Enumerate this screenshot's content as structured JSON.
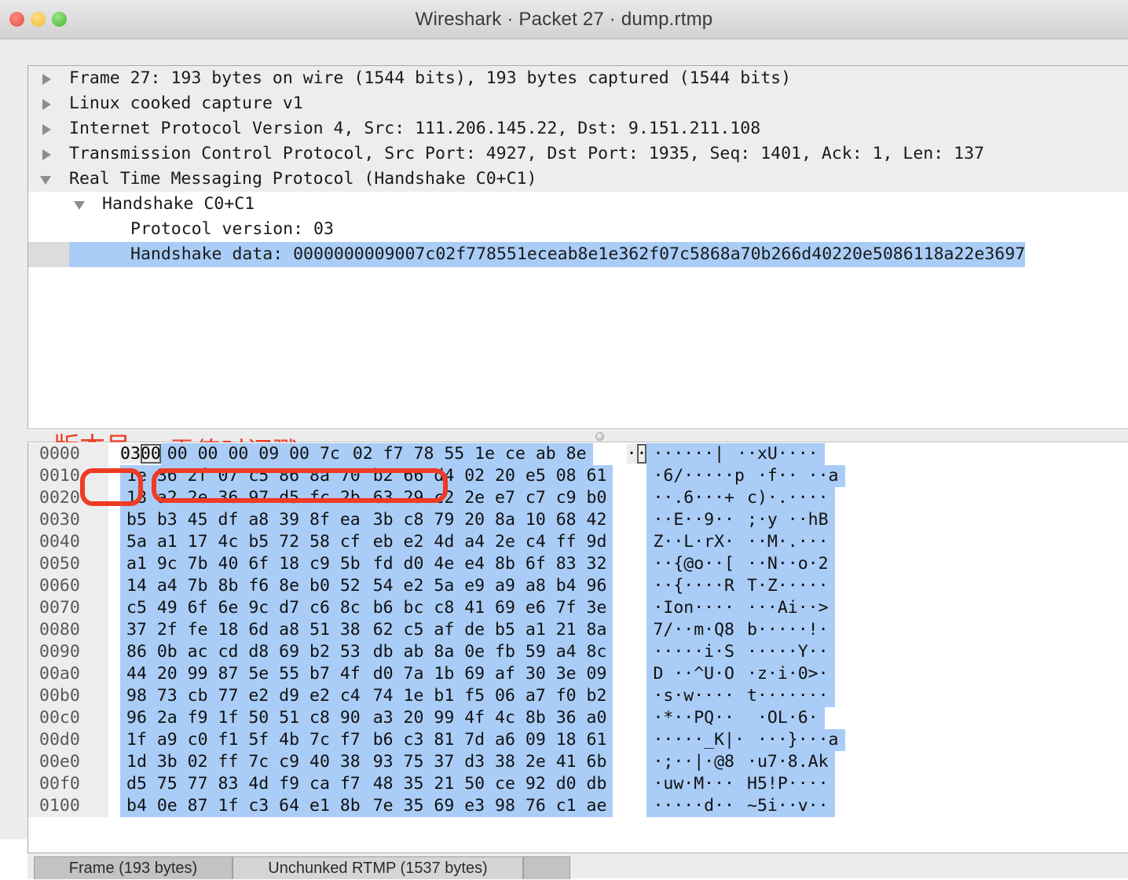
{
  "window": {
    "title": "Wireshark · Packet 27 · dump.rtmp",
    "traffic_lights": [
      "close-red",
      "minimize-yellow",
      "zoom-green"
    ]
  },
  "detail_tree": [
    {
      "level": 0,
      "toggle": "collapsed",
      "text": "Frame 27: 193 bytes on wire (1544 bits), 193 bytes captured (1544 bits)",
      "selected": false
    },
    {
      "level": 0,
      "toggle": "collapsed",
      "text": "Linux cooked capture v1",
      "selected": false
    },
    {
      "level": 0,
      "toggle": "collapsed",
      "text": "Internet Protocol Version 4, Src: 111.206.145.22, Dst: 9.151.211.108",
      "selected": false
    },
    {
      "level": 0,
      "toggle": "collapsed",
      "text": "Transmission Control Protocol, Src Port: 4927, Dst Port: 1935, Seq: 1401, Ack: 1, Len: 137",
      "selected": false
    },
    {
      "level": 0,
      "toggle": "expanded",
      "text": "Real Time Messaging Protocol (Handshake C0+C1)",
      "selected": false
    },
    {
      "level": 1,
      "toggle": "expanded",
      "text": "Handshake C0+C1",
      "selected": false
    },
    {
      "level": 2,
      "toggle": "none",
      "text": "Protocol version: 03",
      "selected": false
    },
    {
      "level": 2,
      "toggle": "none",
      "text": "Handshake data: 0000000009007c02f778551eceab8e1e362f07c5868a70b266d40220e5086118a22e3697",
      "selected": true
    }
  ],
  "annotations": [
    {
      "name": "version-number-label",
      "text": "版本号",
      "color": "#ef3b24"
    },
    {
      "name": "zero-timestamp-label",
      "text": "零值时间戳",
      "color": "#ef3b24"
    }
  ],
  "hex_dump": {
    "rows": [
      {
        "offset": "0000",
        "left": "03 00 00 00 00 09 00 7c",
        "right": "02 f7 78 55 1e ce ab 8e",
        "ascii_left": "········|",
        "ascii_right": "··xU····"
      },
      {
        "offset": "0010",
        "left": "1e 36 2f 07 c5 86 8a 70",
        "right": "b2 66 d4 02 20 e5 08 61",
        "ascii_left": "·6/·····p",
        "ascii_right": "·f·· ··a"
      },
      {
        "offset": "0020",
        "left": "18 a2 2e 36 97 d5 fc 2b",
        "right": "63 29 c2 2e e7 c7 c9 b0",
        "ascii_left": "··.6···+",
        "ascii_right": "c)·.····"
      },
      {
        "offset": "0030",
        "left": "b5 b3 45 df a8 39 8f ea",
        "right": "3b c8 79 20 8a 10 68 42",
        "ascii_left": "··E··9··",
        "ascii_right": ";·y ··hB"
      },
      {
        "offset": "0040",
        "left": "5a a1 17 4c b5 72 58 cf",
        "right": "eb e2 4d a4 2e c4 ff 9d",
        "ascii_left": "Z··L·rX·",
        "ascii_right": "··M·.···"
      },
      {
        "offset": "0050",
        "left": "a1 9c 7b 40 6f 18 c9 5b",
        "right": "fd d0 4e e4 8b 6f 83 32",
        "ascii_left": "··{@o··[",
        "ascii_right": "··N··o·2"
      },
      {
        "offset": "0060",
        "left": "14 a4 7b 8b f6 8e b0 52",
        "right": "54 e2 5a e9 a9 a8 b4 96",
        "ascii_left": "··{····R",
        "ascii_right": "T·Z·····"
      },
      {
        "offset": "0070",
        "left": "c5 49 6f 6e 9c d7 c6 8c",
        "right": "b6 bc c8 41 69 e6 7f 3e",
        "ascii_left": "·Ion····",
        "ascii_right": "···Ai··>"
      },
      {
        "offset": "0080",
        "left": "37 2f fe 18 6d a8 51 38",
        "right": "62 c5 af de b5 a1 21 8a",
        "ascii_left": "7/··m·Q8",
        "ascii_right": "b·····!·"
      },
      {
        "offset": "0090",
        "left": "86 0b ac cd d8 69 b2 53",
        "right": "db ab 8a 0e fb 59 a4 8c",
        "ascii_left": "·····i·S",
        "ascii_right": "·····Y··"
      },
      {
        "offset": "00a0",
        "left": "44 20 99 87 5e 55 b7 4f",
        "right": "d0 7a 1b 69 af 30 3e 09",
        "ascii_left": "D ··^U·O",
        "ascii_right": "·z·i·0>·"
      },
      {
        "offset": "00b0",
        "left": "98 73 cb 77 e2 d9 e2 c4",
        "right": "74 1e b1 f5 06 a7 f0 b2",
        "ascii_left": "·s·w····",
        "ascii_right": "t·······"
      },
      {
        "offset": "00c0",
        "left": "96 2a f9 1f 50 51 c8 90",
        "right": "a3 20 99 4f 4c 8b 36 a0",
        "ascii_left": "·*··PQ··",
        "ascii_right": " ·OL·6·"
      },
      {
        "offset": "00d0",
        "left": "1f a9 c0 f1 5f 4b 7c f7",
        "right": "b6 c3 81 7d a6 09 18 61",
        "ascii_left": "·····_K|·",
        "ascii_right": "···}···a"
      },
      {
        "offset": "00e0",
        "left": "1d 3b 02 ff 7c c9 40 38",
        "right": "93 75 37 d3 38 2e 41 6b",
        "ascii_left": "·;··|·@8",
        "ascii_right": "·u7·8.Ak"
      },
      {
        "offset": "00f0",
        "left": "d5 75 77 83 4d f9 ca f7",
        "right": "48 35 21 50 ce 92 d0 db",
        "ascii_left": "·uw·M···",
        "ascii_right": "H5!P····"
      },
      {
        "offset": "0100",
        "left": "b4 0e 87 1f c3 64 e1 8b",
        "right": "7e 35 69 e3 98 76 c1 ae",
        "ascii_left": "·····d··",
        "ascii_right": "~5i··v··"
      }
    ],
    "first_row_parts": {
      "unselected_byte": "03",
      "boxed_byte": "00",
      "selected_rest_left": "00 00 00 09 00 7c",
      "selected_right": "02 f7 78 55 1e ce ab 8e"
    }
  },
  "tabs": [
    {
      "label": "Frame (193 bytes)",
      "active": true
    },
    {
      "label": "Unchunked RTMP (1537 bytes)",
      "active": false
    }
  ]
}
